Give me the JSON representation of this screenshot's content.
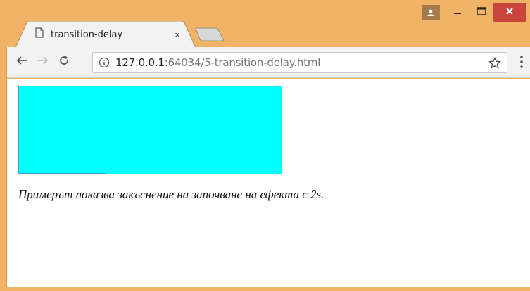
{
  "browser": {
    "tab": {
      "title": "transition-delay",
      "close_glyph": "×"
    },
    "address": {
      "host": "127.0.0.1",
      "path": ":64034/5-transition-delay.html"
    }
  },
  "page": {
    "caption": "Примерът показва закъснение на започване на ефекта с 2s."
  },
  "colors": {
    "frame": "#f0b366",
    "box": "#00ffff",
    "close_button": "#c9443a"
  }
}
